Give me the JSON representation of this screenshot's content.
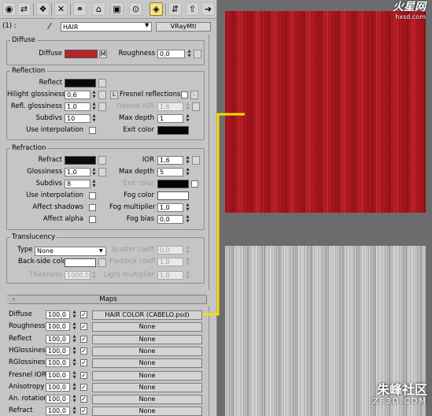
{
  "toolbar": {
    "icons": [
      "teapot-icon",
      "put-to-scene-icon",
      "assign-material-icon",
      "reset-icon",
      "make-unique-icon",
      "put-to-library-icon",
      "material-effects-icon",
      "show-map-icon",
      "show-end-result-icon",
      "go-to-parent-icon",
      "go-forward-icon"
    ]
  },
  "material": {
    "index_label": "(1) :",
    "name": "HAIR",
    "type_button": "VRayMtl"
  },
  "diffuse_group": {
    "title": "Diffuse",
    "diffuse_label": "Diffuse",
    "diffuse_color": "#b4242a",
    "m_button": "M",
    "roughness_label": "Roughness",
    "roughness_value": "0,0"
  },
  "reflection_group": {
    "title": "Reflection",
    "reflect_label": "Reflect",
    "reflect_color": "#0a0a0a",
    "hilight_label": "Hilight glossiness",
    "hilight_value": "0,6",
    "l_button": "L",
    "fresnel_label": "Fresnel reflections",
    "fresnel_l": "L",
    "refl_gloss_label": "Refl. glossiness",
    "refl_gloss_value": "1,0",
    "fresnel_ior_label": "Fresnel IOR",
    "fresnel_ior_value": "1,6",
    "subdivs_label": "Subdivs",
    "subdivs_value": "10",
    "max_depth_label": "Max depth",
    "max_depth_value": "1",
    "use_interp_label": "Use interpolation",
    "exit_color_label": "Exit color",
    "exit_color": "#050505"
  },
  "refraction_group": {
    "title": "Refraction",
    "refract_label": "Refract",
    "refract_color": "#0a0a0a",
    "ior_label": "IOR",
    "ior_value": "1,6",
    "glossiness_label": "Glossiness",
    "glossiness_value": "1,0",
    "max_depth_label": "Max depth",
    "max_depth_value": "5",
    "subdivs_label": "Subdivs",
    "subdivs_value": "8",
    "exit_color_label": "Exit color",
    "exit_color": "#050505",
    "use_interp_label": "Use interpolation",
    "fog_color_label": "Fog color",
    "fog_color": "#ffffff",
    "affect_shadows_label": "Affect shadows",
    "fog_mult_label": "Fog multiplier",
    "fog_mult_value": "1,0",
    "affect_alpha_label": "Affect alpha",
    "fog_bias_label": "Fog bias",
    "fog_bias_value": "0,0"
  },
  "translucency_group": {
    "title": "Translucency",
    "type_label": "Type",
    "type_value": "None",
    "scatter_label": "Scatter coeff",
    "scatter_value": "0,0",
    "backside_label": "Back-side color",
    "backside_color": "#ffffff",
    "fwd_bck_label": "Fwd/bck coeff",
    "fwd_bck_value": "1,0",
    "thickness_label": "Thickness",
    "thickness_value": "1000,0",
    "light_mult_label": "Light multiplier",
    "light_mult_value": "1,0"
  },
  "maps": {
    "title": "Maps",
    "rows": [
      {
        "label": "Diffuse",
        "amount": "100,0",
        "map": "HAIR COLOR (CABELO.psd)"
      },
      {
        "label": "Roughness",
        "amount": "100,0",
        "map": "None"
      },
      {
        "label": "Reflect",
        "amount": "100,0",
        "map": "None"
      },
      {
        "label": "HGlossiness",
        "amount": "100,0",
        "map": "None"
      },
      {
        "label": "RGlossiness",
        "amount": "100,0",
        "map": "None"
      },
      {
        "label": "Fresnel IOR",
        "amount": "100,0",
        "map": "None"
      },
      {
        "label": "Anisotropy",
        "amount": "100,0",
        "map": "None"
      },
      {
        "label": "An. rotation",
        "amount": "100,0",
        "map": "None"
      },
      {
        "label": "Refract",
        "amount": "100,0",
        "map": "None"
      }
    ]
  },
  "watermark": {
    "top_brand": "火星网",
    "top_url": "hxsd.com",
    "bottom_brand": "朱峰社区",
    "bottom_url": "ZF3D.COM"
  },
  "colors": {
    "connector": "#f2e000"
  }
}
